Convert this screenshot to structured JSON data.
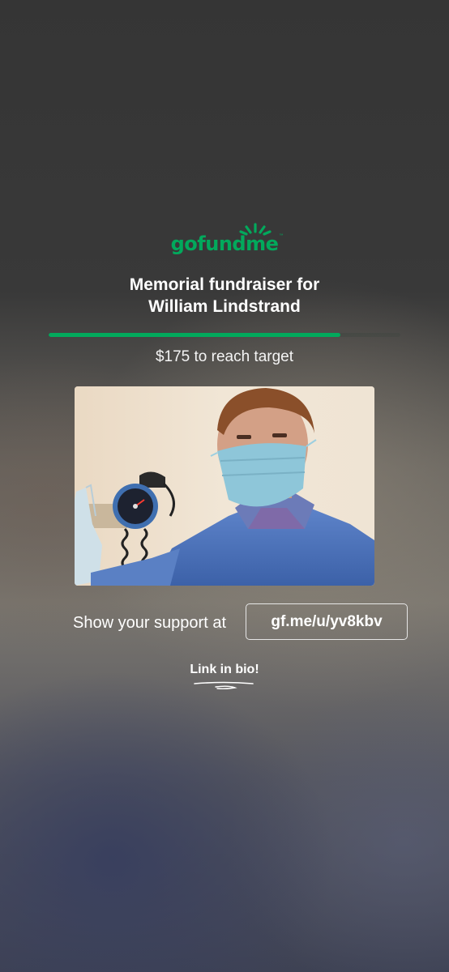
{
  "brand": {
    "name": "gofundme",
    "trademark": "™",
    "color": "#02a95c"
  },
  "title": {
    "line1": "Memorial fundraiser for",
    "line2": "William Lindstrand"
  },
  "progress": {
    "fraction": 0.83,
    "label": "$175 to reach target"
  },
  "photo": {
    "icon": "fundraiser-photo"
  },
  "support": {
    "label": "Show your support at",
    "link": "gf.me/u/yv8kbv"
  },
  "bio": {
    "label": "Link in bio!"
  }
}
